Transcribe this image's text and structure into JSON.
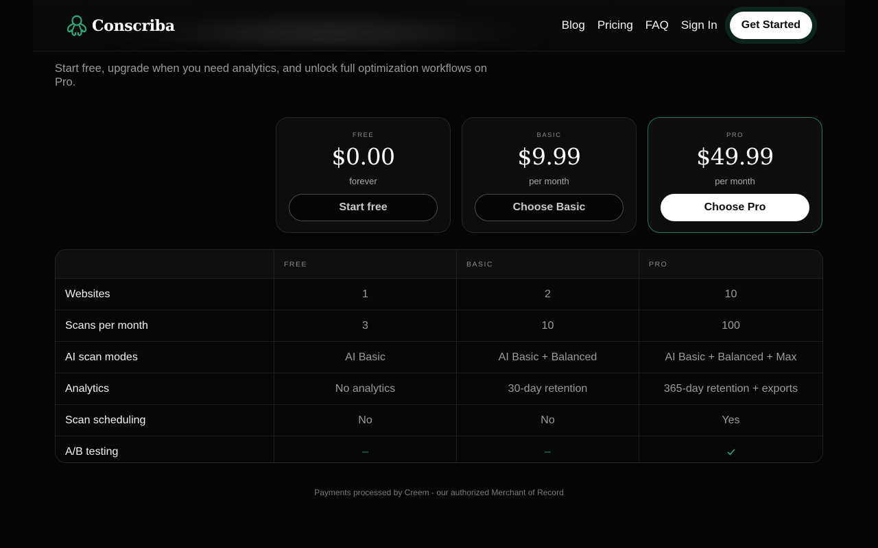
{
  "brand": {
    "name": "Conscriba",
    "icon": "octopus-logo-icon",
    "accent": "#2fa878"
  },
  "nav": {
    "links": [
      "Blog",
      "Pricing",
      "FAQ",
      "Sign In"
    ],
    "cta": "Get Started"
  },
  "hero": {
    "subtitle": "Start free, upgrade when you need analytics, and unlock full optimization workflows on Pro."
  },
  "plans": [
    {
      "kicker": "FREE",
      "price": "$0.00",
      "period": "forever",
      "button": "Start free"
    },
    {
      "kicker": "BASIC",
      "price": "$9.99",
      "period": "per month",
      "button": "Choose Basic"
    },
    {
      "kicker": "PRO",
      "price": "$49.99",
      "period": "per month",
      "button": "Choose Pro"
    }
  ],
  "table": {
    "headers": [
      "FREE",
      "BASIC",
      "PRO"
    ],
    "rows": [
      {
        "feature": "Websites",
        "values": [
          "1",
          "2",
          "10"
        ]
      },
      {
        "feature": "Scans per month",
        "values": [
          "3",
          "10",
          "100"
        ]
      },
      {
        "feature": "AI scan modes",
        "values": [
          "AI Basic",
          "AI Basic + Balanced",
          "AI Basic + Balanced + Max"
        ]
      },
      {
        "feature": "Analytics",
        "values": [
          "No analytics",
          "30-day retention",
          "365-day retention + exports"
        ]
      },
      {
        "feature": "Scan scheduling",
        "values": [
          "No",
          "No",
          "Yes"
        ]
      },
      {
        "feature": "A/B testing",
        "values": [
          "–",
          "–",
          "check-icon"
        ]
      }
    ]
  },
  "footer": {
    "text": "Payments processed by Creem - our authorized Merchant of Record"
  }
}
